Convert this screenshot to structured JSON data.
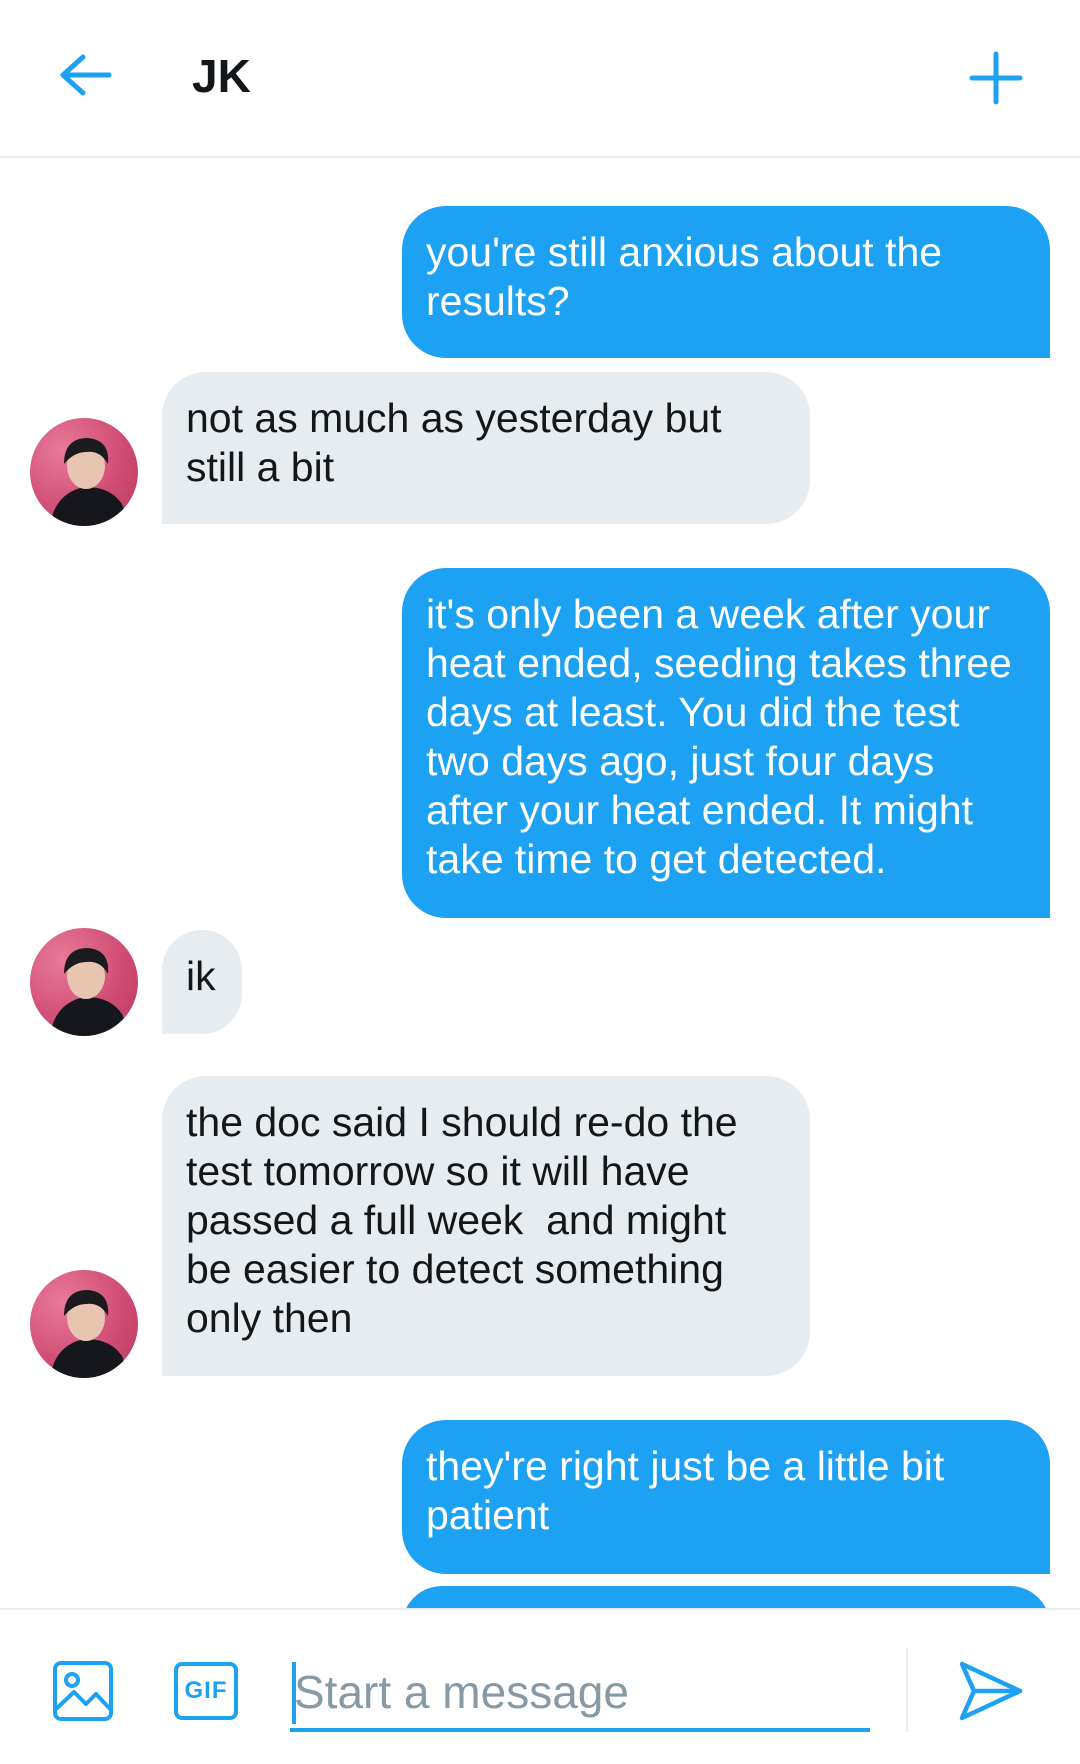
{
  "header": {
    "title": "JK",
    "back_icon": "arrow-left-icon",
    "new_icon": "plus-icon"
  },
  "colors": {
    "accent": "#1da1f2",
    "received_bubble": "#e6ecf0",
    "text": "#14171a",
    "placeholder": "#8899a6"
  },
  "messages": [
    {
      "from": "me",
      "text": "you're still anxious about the\nresults?"
    },
    {
      "from": "JK",
      "text": "not as much as yesterday but\nstill a bit"
    },
    {
      "from": "me",
      "text": "it's only been a week after your\nheat ended, seeding takes three\ndays at least. You did the test\ntwo days ago, just four days\nafter your heat ended. It might\ntake time to get detected."
    },
    {
      "from": "JK",
      "text": "ik"
    },
    {
      "from": "JK",
      "text": "the doc said I should re-do the\ntest tomorrow so it will have\npassed a full week  and might\nbe easier to detect something\nonly then"
    },
    {
      "from": "me",
      "text": "they're right just be a little bit\npatient"
    }
  ],
  "composer": {
    "placeholder": "Start a message",
    "gif_label": "GIF",
    "media_icon": "image-icon",
    "send_icon": "send-icon"
  }
}
